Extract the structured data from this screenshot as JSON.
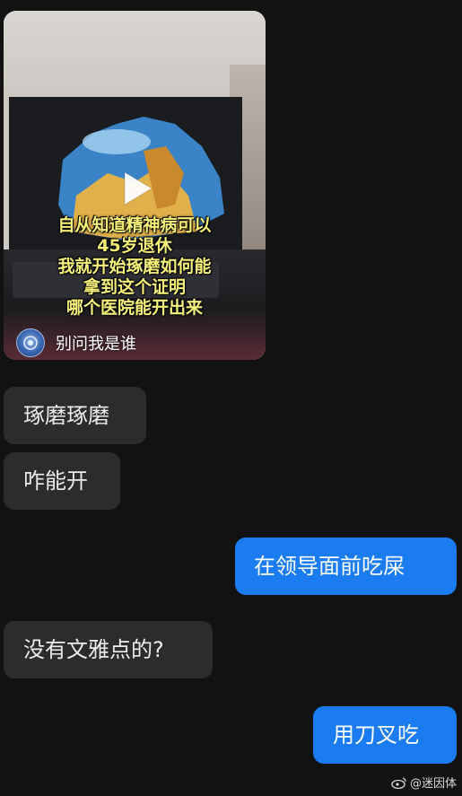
{
  "video_card": {
    "caption_lines": [
      "自从知道精神病可以",
      "45岁退休",
      "我就开始琢磨如何能",
      "拿到这个证明",
      "哪个医院能开出来"
    ],
    "author_name": "别问我是谁"
  },
  "messages": [
    {
      "side": "in",
      "text": "琢磨琢磨"
    },
    {
      "side": "in",
      "text": "咋能开"
    },
    {
      "side": "out",
      "text": "在领导面前吃屎"
    },
    {
      "side": "in",
      "text": "没有文雅点的?"
    },
    {
      "side": "out",
      "text": "用刀叉吃"
    }
  ],
  "watermark": {
    "text": "@迷因体"
  },
  "colors": {
    "background": "#121212",
    "incoming_bubble": "#2c2c2e",
    "outgoing_bubble": "#1a7cf0",
    "caption": "#f5f07a"
  }
}
